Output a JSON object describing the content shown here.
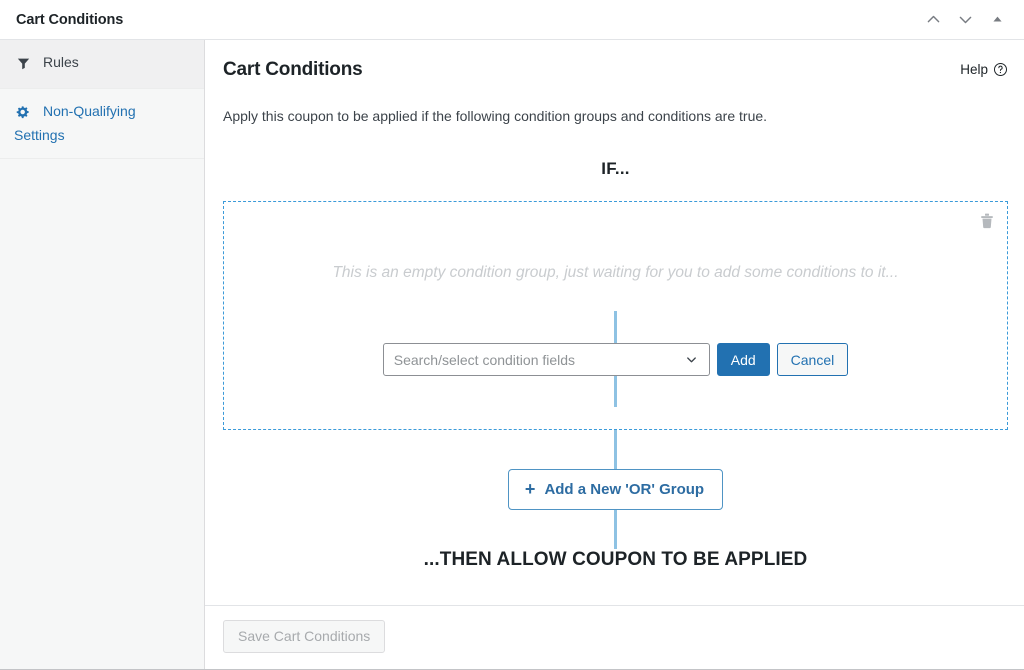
{
  "titlebar": {
    "title": "Cart Conditions",
    "actions": [
      {
        "name": "move-up-icon",
        "label": "Move up"
      },
      {
        "name": "move-down-icon",
        "label": "Move down"
      },
      {
        "name": "toggle-panel-icon",
        "label": "Toggle panel"
      }
    ]
  },
  "sidebar": {
    "items": [
      {
        "label": "Rules",
        "icon": "filter-icon",
        "active": true
      },
      {
        "label": "Non-Qualifying Settings",
        "icon": "gear-icon",
        "active": false
      }
    ]
  },
  "main": {
    "page_title": "Cart Conditions",
    "help_label": "Help",
    "help_icon": "question-circle-icon",
    "intro": "Apply this coupon to be applied if the following condition groups and conditions are true.",
    "if_heading": "IF...",
    "then_heading": "...THEN ALLOW COUPON TO BE APPLIED",
    "group": {
      "empty_message": "This is an empty condition group, just waiting for you to add some conditions to it...",
      "delete_icon": "trash-icon",
      "select_placeholder": "Search/select condition fields",
      "select_chevron_icon": "chevron-down-icon",
      "add_label": "Add",
      "cancel_label": "Cancel"
    },
    "or_group_button": {
      "plus": "+",
      "label": "Add a New 'OR' Group"
    }
  },
  "footer": {
    "save_label": "Save Cart Conditions"
  },
  "colors": {
    "accent_blue": "#2271b1",
    "dashed_border": "#3b9ad9",
    "connector": "#8ec2e3",
    "link_blue": "#2271b1",
    "or_button_text": "#2d6ca2",
    "empty_text": "#c9cccf",
    "title_text": "#1d2327",
    "sidebar_bg": "#f6f7f7",
    "sidebar_active_bg": "#f0f0f1"
  }
}
